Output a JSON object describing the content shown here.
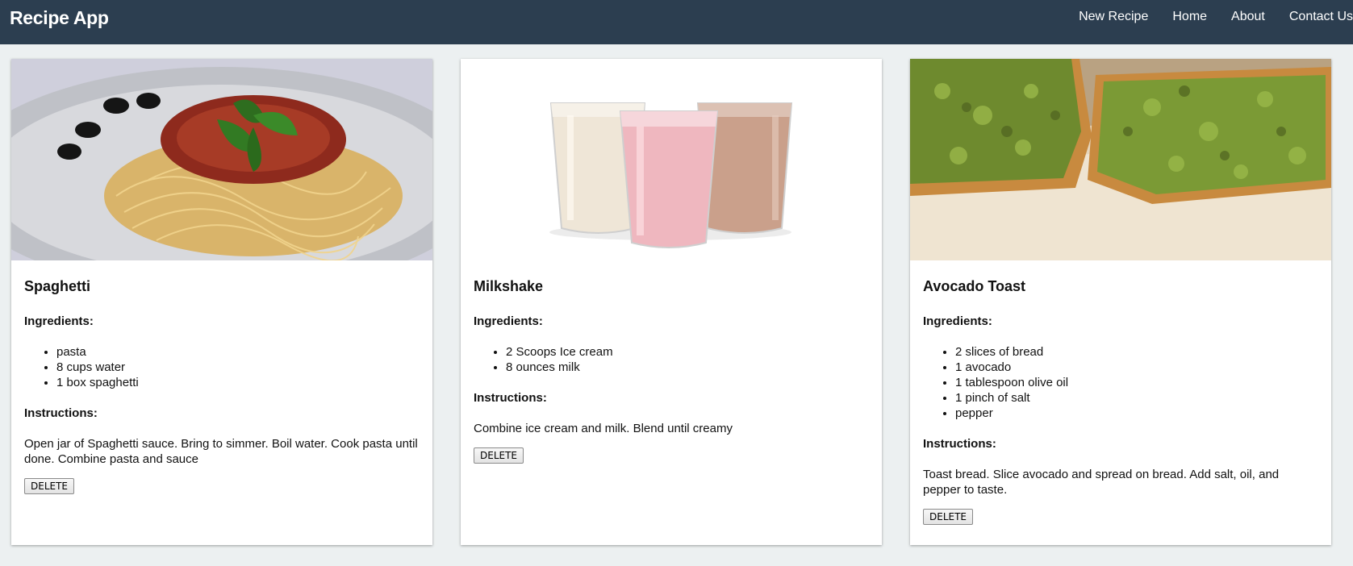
{
  "app": {
    "title": "Recipe App"
  },
  "nav": {
    "items": [
      {
        "label": "New Recipe"
      },
      {
        "label": "Home"
      },
      {
        "label": "About"
      },
      {
        "label": "Contact Us"
      }
    ]
  },
  "sections": {
    "ingredients_label": "Ingredients:",
    "instructions_label": "Instructions:"
  },
  "recipes": [
    {
      "title": "Spaghetti",
      "ingredients": [
        "pasta",
        "8 cups water",
        "1 box spaghetti"
      ],
      "instructions": "Open jar of Spaghetti sauce. Bring to simmer. Boil water. Cook pasta until done. Combine pasta and sauce",
      "delete_label": "DELETE"
    },
    {
      "title": "Milkshake",
      "ingredients": [
        "2 Scoops Ice cream",
        "8 ounces milk"
      ],
      "instructions": "Combine ice cream and milk. Blend until creamy",
      "delete_label": "DELETE"
    },
    {
      "title": "Avocado Toast",
      "ingredients": [
        "2 slices of bread",
        "1 avocado",
        "1 tablespoon olive oil",
        "1 pinch of salt",
        "pepper"
      ],
      "instructions": "Toast bread. Slice avocado and spread on bread. Add salt, oil, and pepper to taste.",
      "delete_label": "DELETE"
    }
  ]
}
